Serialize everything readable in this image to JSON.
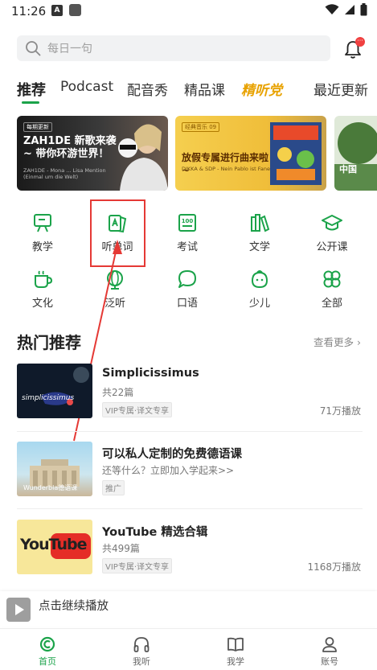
{
  "status_bar": {
    "time": "11:26",
    "notif_a": "A"
  },
  "search": {
    "placeholder": "每日一句",
    "bell_badge": "···"
  },
  "tabs": [
    {
      "label": "推荐"
    },
    {
      "label": "Podcast"
    },
    {
      "label": "配音秀"
    },
    {
      "label": "精品课"
    },
    {
      "label": "精听党"
    },
    {
      "label": "最近更新"
    }
  ],
  "banners": [
    {
      "tag": "每期更新",
      "title": "ZAH1DE 新歌来袭~ 带你环游世界！",
      "subtitle": "ZAH1DE - Mona ... Lisa Mention (Einmal um die Welt)"
    },
    {
      "tag": "经典音乐 09",
      "title": "放假专属进行曲来啦~",
      "subtitle": "DIKKA & SDP - Nein Pablo ist Fanen"
    },
    {
      "label": "中国"
    }
  ],
  "categories": [
    {
      "label": "教学",
      "icon": "teaching-icon"
    },
    {
      "label": "听单词",
      "icon": "word-cards-icon"
    },
    {
      "label": "考试",
      "icon": "exam-100-icon"
    },
    {
      "label": "文学",
      "icon": "books-icon"
    },
    {
      "label": "公开课",
      "icon": "graduation-cap-icon"
    },
    {
      "label": "文化",
      "icon": "cup-icon"
    },
    {
      "label": "泛听",
      "icon": "globe-icon"
    },
    {
      "label": "口语",
      "icon": "chat-bubble-icon"
    },
    {
      "label": "少儿",
      "icon": "kid-face-icon"
    },
    {
      "label": "全部",
      "icon": "clover-icon"
    }
  ],
  "section": {
    "title": "热门推荐",
    "more": "查看更多"
  },
  "items": [
    {
      "title": "Simplicissimus",
      "sub": "共22篇",
      "tag": "VIP专属·译文专享",
      "plays": "71万播放",
      "thumb_text": "simplicissimus"
    },
    {
      "title": "可以私人定制的免费德语课",
      "sub": "还等什么？立即加入学起来>>",
      "tag": "推广",
      "plays": "",
      "thumb_text": "Wunderbla德语课"
    },
    {
      "title": "YouTube 精选合辑",
      "sub": "共499篇",
      "tag": "VIP专属·译文专享",
      "plays": "1168万播放",
      "thumb_text": "YouTube"
    }
  ],
  "mini_player": {
    "text": "点击继续播放"
  },
  "bottom_nav": [
    {
      "label": "首页"
    },
    {
      "label": "我听"
    },
    {
      "label": "我学"
    },
    {
      "label": "账号"
    }
  ],
  "colors": {
    "accent": "#1ba34a",
    "highlight": "#e53935",
    "tab_special": "#e8a200"
  }
}
